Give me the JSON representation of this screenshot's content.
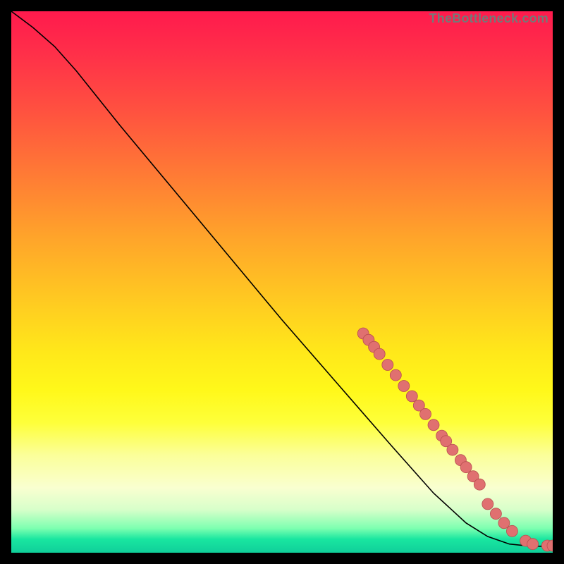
{
  "watermark": "TheBottleneck.com",
  "palette": {
    "marker_fill": "#e07070",
    "marker_stroke": "#b84f4f",
    "curve": "#000000",
    "frame": "#000000"
  },
  "chart_data": {
    "type": "line",
    "title": "",
    "xlabel": "",
    "ylabel": "",
    "xlim": [
      0,
      100
    ],
    "ylim": [
      0,
      100
    ],
    "curve": [
      {
        "x": 0,
        "y": 100
      },
      {
        "x": 4,
        "y": 97
      },
      {
        "x": 8,
        "y": 93.5
      },
      {
        "x": 12,
        "y": 89
      },
      {
        "x": 20,
        "y": 79
      },
      {
        "x": 30,
        "y": 67
      },
      {
        "x": 40,
        "y": 55
      },
      {
        "x": 50,
        "y": 43
      },
      {
        "x": 60,
        "y": 31.5
      },
      {
        "x": 70,
        "y": 20
      },
      {
        "x": 78,
        "y": 11
      },
      {
        "x": 84,
        "y": 5.5
      },
      {
        "x": 88,
        "y": 3
      },
      {
        "x": 92,
        "y": 1.6
      },
      {
        "x": 96,
        "y": 1.2
      },
      {
        "x": 100,
        "y": 1.2
      }
    ],
    "markers": [
      {
        "x": 65,
        "y": 40.5
      },
      {
        "x": 66,
        "y": 39.3
      },
      {
        "x": 67,
        "y": 38.0
      },
      {
        "x": 68,
        "y": 36.7
      },
      {
        "x": 69.5,
        "y": 34.7
      },
      {
        "x": 71,
        "y": 32.8
      },
      {
        "x": 72.5,
        "y": 30.8
      },
      {
        "x": 74,
        "y": 28.9
      },
      {
        "x": 75.3,
        "y": 27.2
      },
      {
        "x": 76.5,
        "y": 25.6
      },
      {
        "x": 78,
        "y": 23.6
      },
      {
        "x": 79.5,
        "y": 21.6
      },
      {
        "x": 80.3,
        "y": 20.6
      },
      {
        "x": 81.5,
        "y": 19.0
      },
      {
        "x": 83,
        "y": 17.1
      },
      {
        "x": 84,
        "y": 15.8
      },
      {
        "x": 85.3,
        "y": 14.1
      },
      {
        "x": 86.5,
        "y": 12.6
      },
      {
        "x": 88,
        "y": 9.0
      },
      {
        "x": 89.5,
        "y": 7.2
      },
      {
        "x": 91,
        "y": 5.5
      },
      {
        "x": 92.5,
        "y": 4.0
      },
      {
        "x": 95,
        "y": 2.2
      },
      {
        "x": 96.3,
        "y": 1.6
      },
      {
        "x": 99,
        "y": 1.3
      },
      {
        "x": 100,
        "y": 1.3
      }
    ],
    "marker_radius": 8
  }
}
